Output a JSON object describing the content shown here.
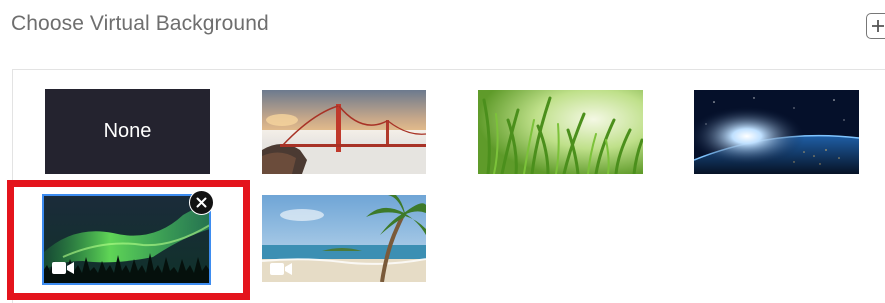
{
  "header": {
    "title": "Choose Virtual Background",
    "add_icon": "plus-icon"
  },
  "backgrounds": [
    {
      "label": "None",
      "type": "none"
    },
    {
      "type": "image",
      "subject": "golden-gate-bridge"
    },
    {
      "type": "image",
      "subject": "green-grass"
    },
    {
      "type": "image",
      "subject": "earth-from-space"
    },
    {
      "type": "video",
      "subject": "aurora",
      "selected": true,
      "video_icon": "video-camera-icon",
      "remove_icon": "close-icon"
    },
    {
      "type": "video",
      "subject": "beach-palm",
      "video_icon": "video-camera-icon"
    }
  ],
  "colors": {
    "highlight": "#e4141c",
    "selected_border": "#3d8cf0",
    "none_tile": "#24232f"
  }
}
